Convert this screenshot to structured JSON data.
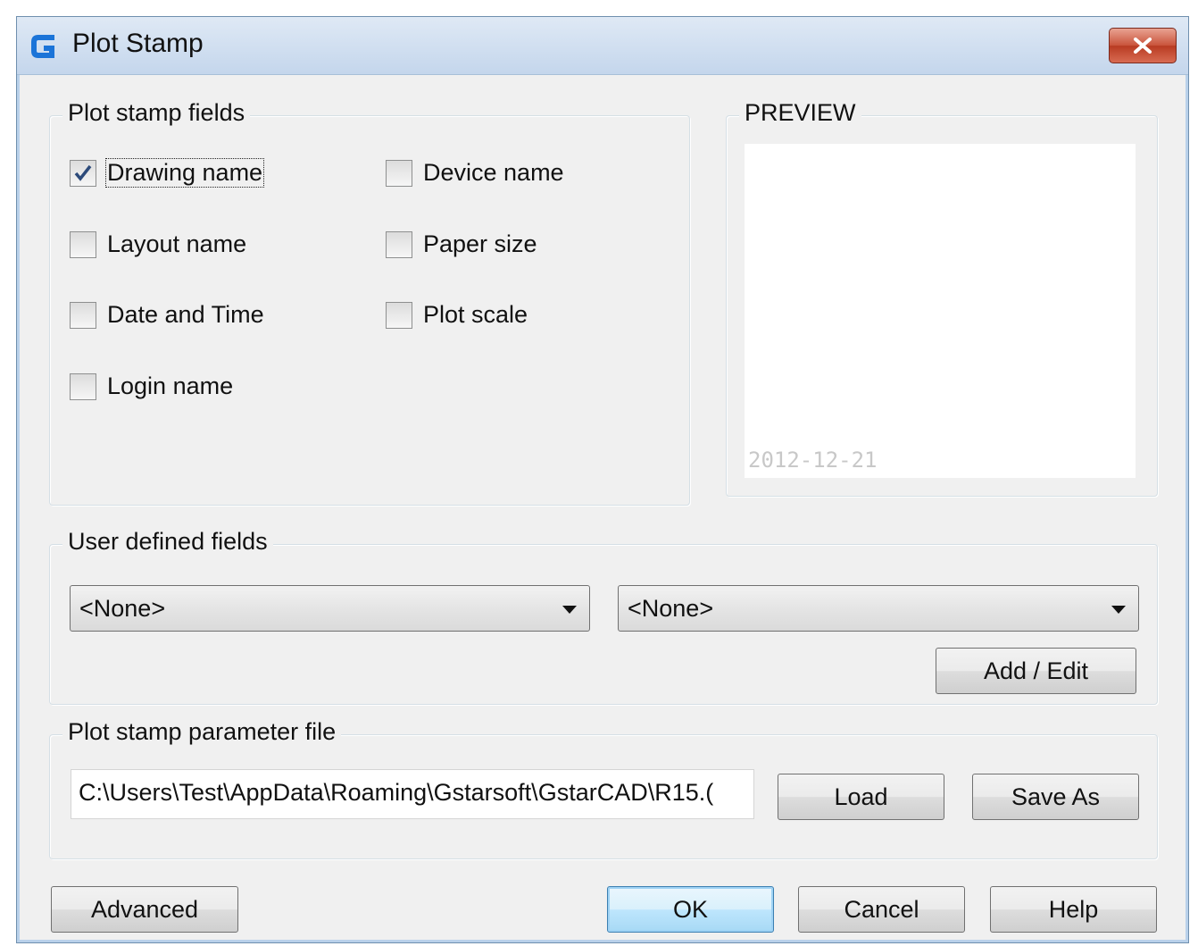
{
  "window": {
    "title": "Plot Stamp",
    "close_label": "Close",
    "colors": {
      "title_gradient_top": "#dfe9f5",
      "close_button": "#c9533b",
      "dialog_bg": "#f0f0f0"
    }
  },
  "icons": {
    "app": "gstarcad-logo-icon",
    "close": "close-icon",
    "checkmark": "checkmark-icon",
    "dropdown": "chevron-down-icon"
  },
  "plot_stamp_fields": {
    "legend": "Plot stamp fields",
    "items": [
      {
        "label": "Drawing name",
        "checked": true
      },
      {
        "label": "Device name",
        "checked": false
      },
      {
        "label": "Layout name",
        "checked": false
      },
      {
        "label": "Paper size",
        "checked": false
      },
      {
        "label": "Date and Time",
        "checked": false
      },
      {
        "label": "Plot scale",
        "checked": false
      },
      {
        "label": "Login name",
        "checked": false
      }
    ]
  },
  "preview": {
    "legend": "PREVIEW",
    "stamp_text": "2012-12-21"
  },
  "user_defined_fields": {
    "legend": "User defined fields",
    "field1": "<None>",
    "field2": "<None>",
    "add_edit_label": "Add / Edit"
  },
  "parameter_file": {
    "legend": "Plot stamp parameter file",
    "path": "C:\\Users\\Test\\AppData\\Roaming\\Gstarsoft\\GstarCAD\\R15.(",
    "load_label": "Load",
    "save_as_label": "Save As"
  },
  "footer": {
    "advanced_label": "Advanced",
    "ok_label": "OK",
    "cancel_label": "Cancel",
    "help_label": "Help"
  }
}
